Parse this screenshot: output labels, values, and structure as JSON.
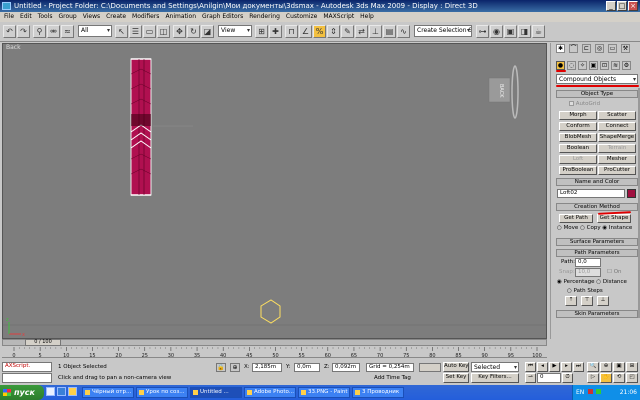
{
  "window": {
    "title": "Untitled    - Project Folder: C:\\Documents and Settings\\Anilgin\\Мои документы\\3dsmax    - Autodesk 3ds Max  2009       - Display : Direct 3D",
    "minimize": "_",
    "maximize": "□",
    "close": "×"
  },
  "menu": [
    "File",
    "Edit",
    "Tools",
    "Group",
    "Views",
    "Create",
    "Modifiers",
    "Animation",
    "Graph Editors",
    "Rendering",
    "Customize",
    "MAXScript",
    "Help"
  ],
  "toolbar": {
    "selection_filter": "All",
    "ref_coord": "View",
    "selection_set": "Create Selection Set"
  },
  "viewport": {
    "label": "Back",
    "viewcube_label": "BACK"
  },
  "command_panel": {
    "category_dropdown": "Compound Objects",
    "object_type_header": "Object Type",
    "autogrid_label": "AutoGrid",
    "buttons": [
      [
        "Morph",
        "Scatter"
      ],
      [
        "Conform",
        "Connect"
      ],
      [
        "BlobMesh",
        "ShapeMerge"
      ],
      [
        "Boolean",
        "Terrain"
      ],
      [
        "Loft",
        "Mesher"
      ],
      [
        "ProBoolean",
        "ProCutter"
      ]
    ],
    "name_color_header": "Name and Color",
    "object_name": "Loft02",
    "object_color": "#a01040",
    "creation_method_header": "Creation Method",
    "get_path": "Get Path",
    "get_shape": "Get Shape",
    "radio_move": "Move",
    "radio_copy": "Copy",
    "radio_instance": "Instance",
    "surface_params_header": "Surface Parameters",
    "path_params_header": "Path Parameters",
    "path_label": "Path:",
    "path_value": "0,0",
    "on_label": "On",
    "snap_label": "Snap:",
    "snap_value": "10,0",
    "percentage_label": "Percentage",
    "distance_label": "Distance",
    "path_steps_label": "Path Steps",
    "skin_params_header": "Skin Parameters"
  },
  "timeline": {
    "counter": "0 / 100",
    "ticks": [
      "0",
      "5",
      "10",
      "15",
      "20",
      "25",
      "30",
      "35",
      "40",
      "45",
      "50",
      "55",
      "60",
      "65",
      "70",
      "75",
      "80",
      "85",
      "90",
      "95",
      "100"
    ]
  },
  "status": {
    "maxscript": "AXScript.",
    "selected": "1 Object Selected",
    "prompt": "Click and drag to pan a non-camera view",
    "x_label": "X:",
    "x_value": "2,185m",
    "y_label": "Y:",
    "y_value": "0,0m",
    "z_label": "Z:",
    "z_value": "0,092m",
    "grid": "Grid = 0,254m",
    "add_time_tag": "Add Time Tag",
    "auto_key": "Auto Key",
    "set_key": "Set Key",
    "key_mode": "Selected",
    "key_filters": "Key Filters...",
    "frame": "0"
  },
  "taskbar": {
    "start": "пуск",
    "tasks": [
      "Чёрный отр...",
      "Урок по соз...",
      "Untitled ...",
      "Adobe Photo...",
      "33.PNG - Paint",
      "3 Проводник"
    ],
    "lang": "EN",
    "clock": "21:06"
  },
  "colors": {
    "accent_red": "#e00000",
    "object_magenta": "#a01040"
  }
}
